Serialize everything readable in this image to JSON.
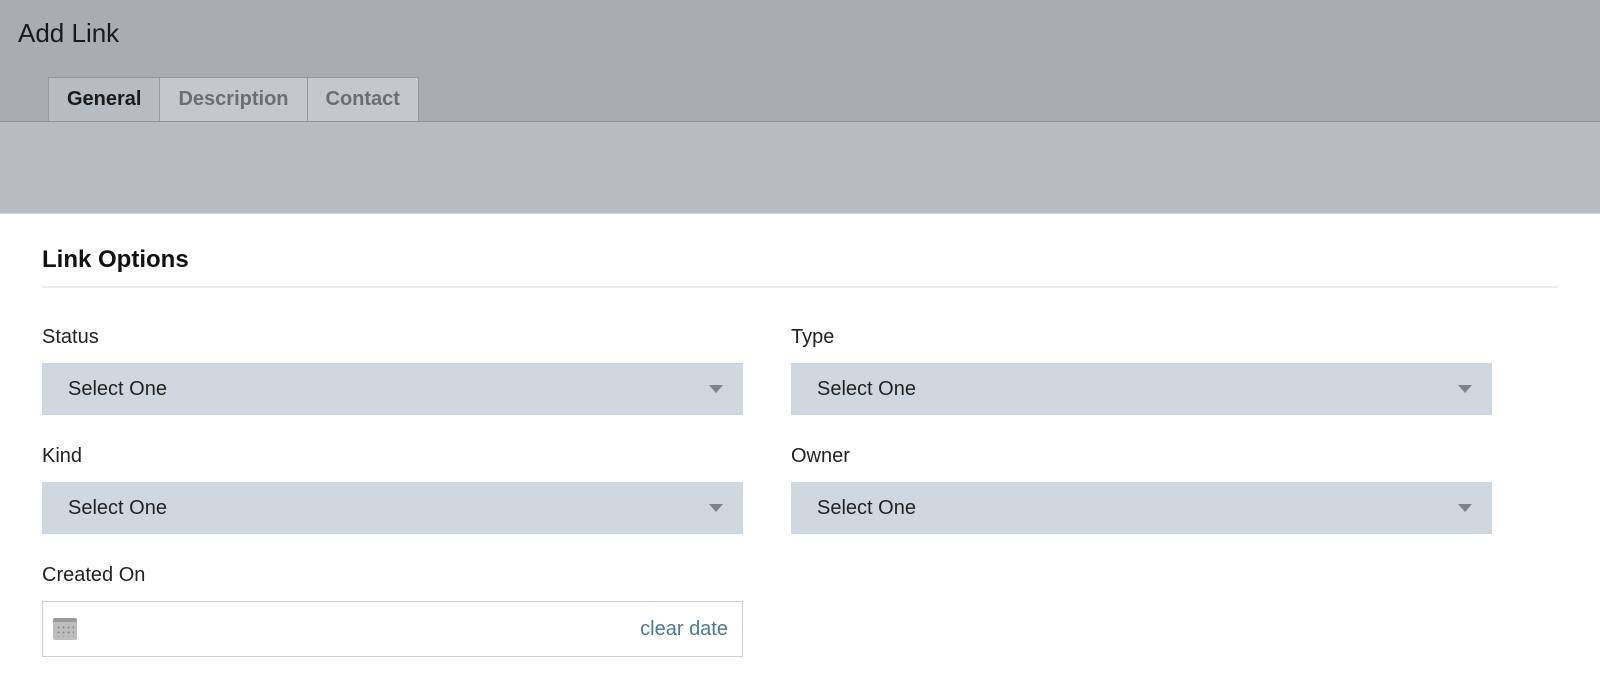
{
  "page": {
    "title": "Add Link"
  },
  "tabs": {
    "general": "General",
    "description": "Description",
    "contact": "Contact"
  },
  "section": {
    "link_options": "Link Options"
  },
  "fields": {
    "status": {
      "label": "Status",
      "value": "Select One"
    },
    "type": {
      "label": "Type",
      "value": "Select One"
    },
    "kind": {
      "label": "Kind",
      "value": "Select One"
    },
    "owner": {
      "label": "Owner",
      "value": "Select One"
    },
    "created_on": {
      "label": "Created On",
      "clear": "clear date"
    }
  }
}
